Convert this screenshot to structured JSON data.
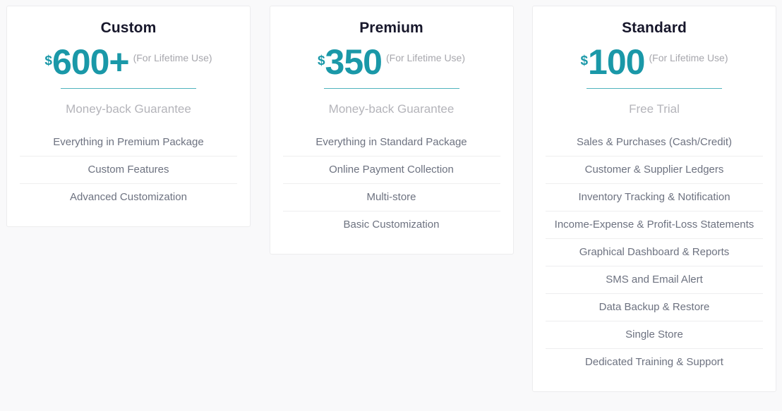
{
  "page": {
    "background_color": "#f9f9fa",
    "accent_color": "#1a98a8",
    "rule_color": "#4fb3bd",
    "divider_color": "#eeeeef",
    "title_color": "#17172b",
    "feature_text_color": "#6d7280",
    "muted_text_color": "#b4b4ba"
  },
  "plans": [
    {
      "title": "Custom",
      "currency": "$",
      "amount": "600+",
      "period_note": "(For Lifetime Use)",
      "guarantee": "Money-back Guarantee",
      "features": [
        "Everything in Premium Package",
        "Custom Features",
        "Advanced Customization"
      ]
    },
    {
      "title": "Premium",
      "currency": "$",
      "amount": "350",
      "period_note": "(For Lifetime Use)",
      "guarantee": "Money-back Guarantee",
      "features": [
        "Everything in Standard Package",
        "Online Payment Collection",
        "Multi-store",
        "Basic Customization"
      ]
    },
    {
      "title": "Standard",
      "currency": "$",
      "amount": "100",
      "period_note": "(For Lifetime Use)",
      "guarantee": "Free Trial",
      "features": [
        "Sales & Purchases (Cash/Credit)",
        "Customer & Supplier Ledgers",
        "Inventory Tracking & Notification",
        "Income-Expense & Profit-Loss Statements",
        "Graphical Dashboard & Reports",
        "SMS and Email Alert",
        "Data Backup & Restore",
        "Single Store",
        "Dedicated Training & Support"
      ]
    }
  ]
}
